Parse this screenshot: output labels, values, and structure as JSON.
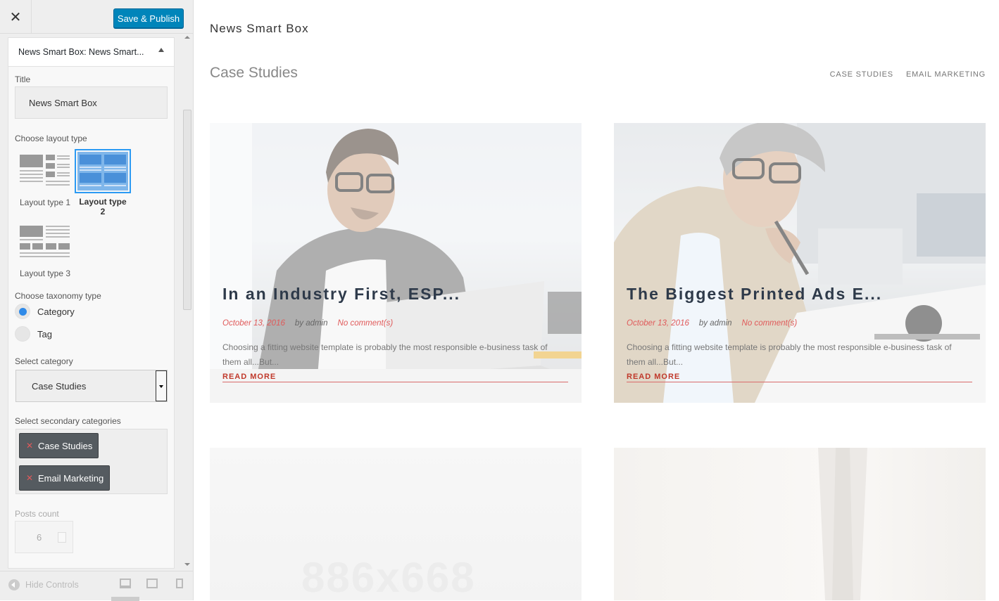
{
  "sidebar": {
    "close_icon": "close-icon",
    "publish_label": "Save & Publish",
    "panel_title": "News Smart Box:",
    "panel_subtitle": "News Smart...",
    "title_label": "Title",
    "title_value": "News Smart Box",
    "layout_label": "Choose layout type",
    "layouts": [
      {
        "label": "Layout type 1",
        "selected": false
      },
      {
        "label": "Layout type",
        "label2": "2",
        "selected": true
      },
      {
        "label": "Layout type 3",
        "selected": false
      }
    ],
    "taxonomy_label": "Choose taxonomy type",
    "taxonomy_options": [
      {
        "label": "Category",
        "checked": true
      },
      {
        "label": "Tag",
        "checked": false
      }
    ],
    "category_label": "Select category",
    "category_value": "Case Studies",
    "secondary_label": "Select secondary categories",
    "secondary_chips": [
      "Case Studies",
      "Email Marketing"
    ],
    "posts_count_label": "Posts count",
    "posts_count_value": "6",
    "hide_controls": "Hide Controls"
  },
  "preview": {
    "widget_title": "News Smart Box",
    "section_title": "Case Studies",
    "tabs": [
      "CASE STUDIES",
      "EMAIL MARKETING"
    ],
    "posts": [
      {
        "title": "In an Industry First, ESP...",
        "date": "October 13, 2016",
        "author": "by admin",
        "comments": "No comment(s)",
        "excerpt": "Choosing a fitting website template is probably the most responsible e-business task of them all...But...",
        "read_more": "READ MORE"
      },
      {
        "title": "The Biggest Printed Ads E...",
        "date": "October 13, 2016",
        "author": "by admin",
        "comments": "No comment(s)",
        "excerpt": "Choosing a fitting website template is probably the most responsible e-business task of them all...But...",
        "read_more": "READ MORE"
      }
    ],
    "placeholder_text": "886x668"
  },
  "colors": {
    "accent": "#0085ba",
    "radio_on": "#2f8ae8",
    "meta_red": "#e05a5a",
    "selected_layout": "#2b9af3"
  }
}
